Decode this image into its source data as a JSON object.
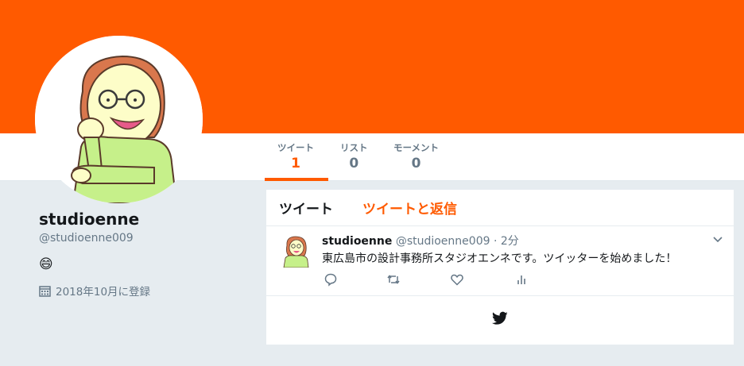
{
  "colors": {
    "accent": "#ff5a00",
    "muted": "#657786",
    "background": "#e6ecf0"
  },
  "profile": {
    "name": "studioenne",
    "handle": "@studioenne009",
    "bio_emoji": "😄",
    "joined": "2018年10月に登録"
  },
  "stats": [
    {
      "label": "ツイート",
      "value": "1"
    },
    {
      "label": "リスト",
      "value": "0"
    },
    {
      "label": "モーメント",
      "value": "0"
    }
  ],
  "timeline": {
    "tabs": [
      "ツイート",
      "ツイートと返信"
    ],
    "tweet": {
      "name": "studioenne",
      "handle": "@studioenne009",
      "time": "· 2分",
      "text": "東広島市の設計事務所スタジオエンネです。ツイッターを始めました！"
    },
    "actions": [
      "reply-icon",
      "retweet-icon",
      "like-icon",
      "analytics-icon"
    ]
  },
  "icons": {
    "calendar": "calendar-icon",
    "caret": "chevron-down-icon",
    "logo": "twitter-bird-icon"
  }
}
